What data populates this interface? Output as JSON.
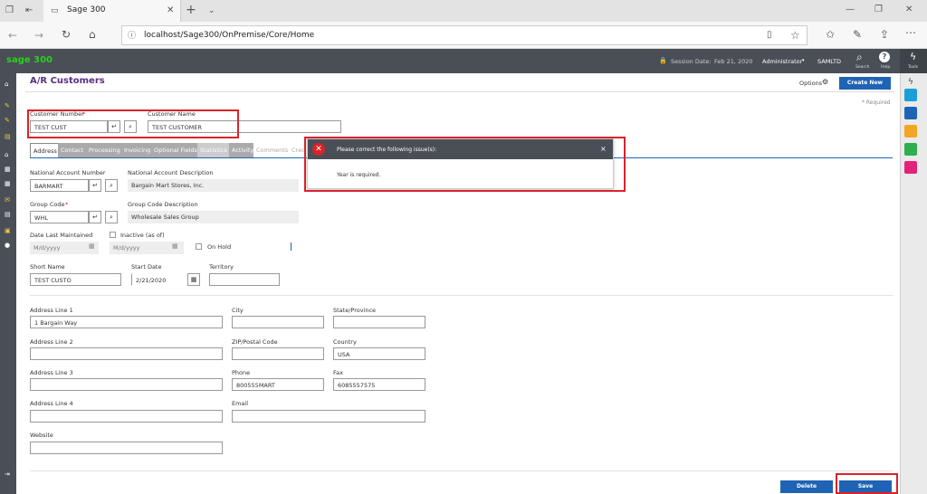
{
  "browser": {
    "tab_title": "Sage 300",
    "url": "localhost/Sage300/OnPremise/Core/Home"
  },
  "header": {
    "logo": "sage 300",
    "session_label": "Session Date:",
    "session_date": "Feb 21, 2020",
    "user": "Administrator",
    "company": "SAMLTD",
    "search_label": "Search",
    "help_label": "Help",
    "tools_label": "Tools"
  },
  "page": {
    "title": "A/R Customers",
    "options_label": "Options",
    "create_new_label": "Create New",
    "required_note": "* Required"
  },
  "customer": {
    "number_label": "Customer Number",
    "number_value": "TEST CUST",
    "name_label": "Customer Name",
    "name_value": "TEST CUSTOMER"
  },
  "tabs": [
    "Address",
    "Contact",
    "Processing",
    "Invoicing",
    "Optional Fields",
    "Statistics",
    "Activity",
    "Comments",
    "Cred"
  ],
  "form": {
    "nat_acct_label": "National Account Number",
    "nat_acct_value": "BARMART",
    "nat_desc_label": "National Account Description",
    "nat_desc_value": "Bargain Mart Stores, Inc.",
    "group_code_label": "Group Code",
    "group_code_value": "WHL",
    "group_desc_label": "Group Code Description",
    "group_desc_value": "Wholesale Sales Group",
    "date_maint_label": "Date Last Maintained",
    "date_maint_placeholder": "M/d/yyyy",
    "inactive_label": "Inactive (as of)",
    "inactive_placeholder": "M/d/yyyy",
    "on_hold_label": "On Hold",
    "short_name_label": "Short Name",
    "short_name_value": "TEST CUSTO",
    "start_date_label": "Start Date",
    "start_date_value": "2/21/2020",
    "territory_label": "Territory",
    "addr1_label": "Address Line 1",
    "addr1_value": "1 Bargain Way",
    "city_label": "City",
    "state_label": "State/Province",
    "addr2_label": "Address Line 2",
    "zip_label": "ZIP/Postal Code",
    "country_label": "Country",
    "country_value": "USA",
    "addr3_label": "Address Line 3",
    "phone_label": "Phone",
    "phone_value": "800555MART",
    "fax_label": "Fax",
    "fax_value": "6085557575",
    "addr4_label": "Address Line 4",
    "email_label": "Email",
    "website_label": "Website"
  },
  "error": {
    "title": "Please correct the following issue(s):",
    "message": "Year is required.",
    "close": "×"
  },
  "footer": {
    "delete_label": "Delete",
    "save_label": "Save"
  },
  "colors": {
    "accent": "#1f63b5",
    "brand_green": "#29d01f",
    "error_red": "#d9232b",
    "title_purple": "#5a2d82"
  }
}
